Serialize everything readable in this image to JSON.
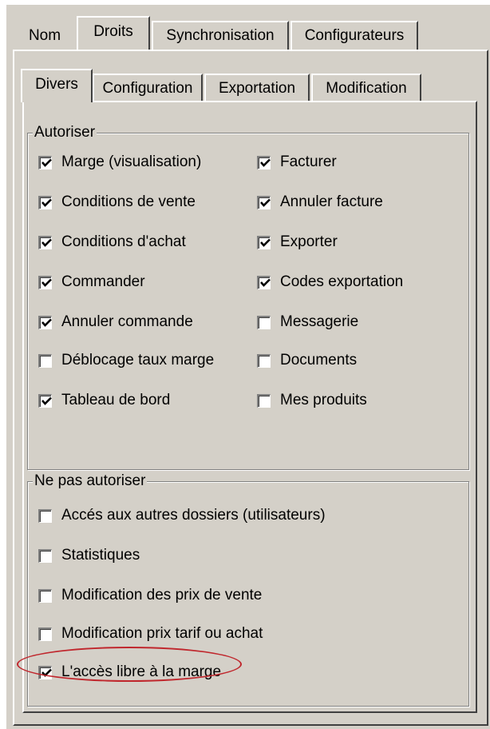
{
  "outer_tabs": [
    {
      "label": "Nom",
      "active": false
    },
    {
      "label": "Droits",
      "active": true
    },
    {
      "label": "Synchronisation",
      "active": false
    },
    {
      "label": "Configurateurs",
      "active": false
    }
  ],
  "inner_tabs": [
    {
      "label": "Divers",
      "active": true
    },
    {
      "label": "Configuration",
      "active": false
    },
    {
      "label": "Exportation",
      "active": false
    },
    {
      "label": "Modification",
      "active": false
    }
  ],
  "autoriser": {
    "title": "Autoriser",
    "left": [
      {
        "label": "Marge (visualisation)",
        "checked": true
      },
      {
        "label": "Conditions de vente",
        "checked": true
      },
      {
        "label": "Conditions d'achat",
        "checked": true
      },
      {
        "label": "Commander",
        "checked": true
      },
      {
        "label": "Annuler commande",
        "checked": true
      },
      {
        "label": "Déblocage taux marge",
        "checked": false
      },
      {
        "label": "Tableau de bord",
        "checked": true
      }
    ],
    "right": [
      {
        "label": "Facturer",
        "checked": true
      },
      {
        "label": "Annuler facture",
        "checked": true
      },
      {
        "label": "Exporter",
        "checked": true
      },
      {
        "label": "Codes exportation",
        "checked": true
      },
      {
        "label": "Messagerie",
        "checked": false
      },
      {
        "label": "Documents",
        "checked": false
      },
      {
        "label": "Mes produits",
        "checked": false
      }
    ]
  },
  "ne_pas_autoriser": {
    "title": "Ne pas autoriser",
    "items": [
      {
        "label": "Accés aux autres dossiers (utilisateurs)",
        "checked": false
      },
      {
        "label": "Statistiques",
        "checked": false
      },
      {
        "label": "Modification des prix de vente",
        "checked": false
      },
      {
        "label": "Modification prix tarif ou achat",
        "checked": false
      },
      {
        "label": "L'accès libre à la marge",
        "checked": true
      }
    ]
  },
  "colors": {
    "dialog_bg": "#d4d0c8",
    "highlight_ellipse": "#c0272d"
  }
}
